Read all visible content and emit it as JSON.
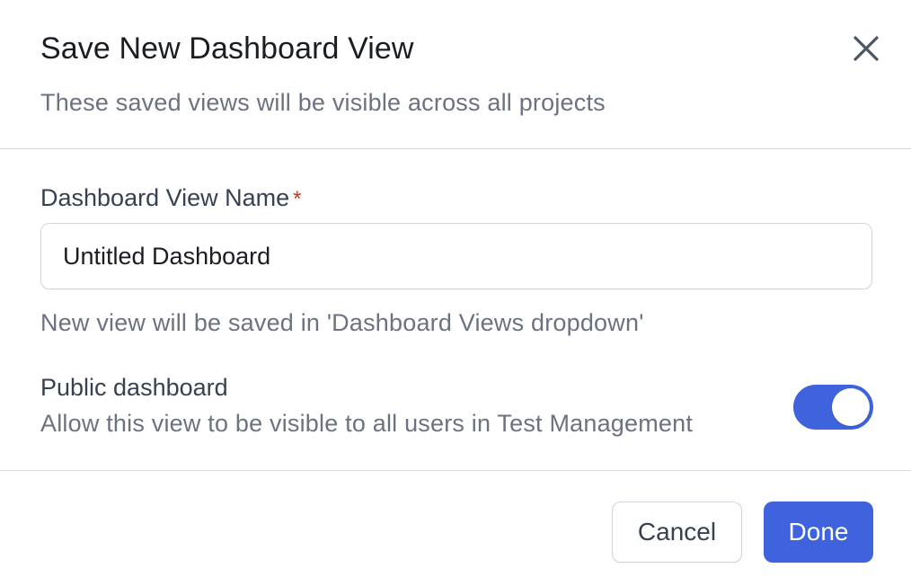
{
  "dialog": {
    "title": "Save New Dashboard View",
    "subtitle": "These saved views will be visible across all projects",
    "close_icon": "close-icon"
  },
  "name_field": {
    "label": "Dashboard View Name",
    "required_mark": "*",
    "value": "Untitled Dashboard",
    "helper": "New view will be saved in 'Dashboard Views dropdown'"
  },
  "public_toggle": {
    "title": "Public dashboard",
    "description": "Allow this view to be visible to all users in Test Management",
    "checked": true
  },
  "footer": {
    "cancel_label": "Cancel",
    "done_label": "Done"
  },
  "colors": {
    "accent": "#3e63dd",
    "required": "#c0392b",
    "muted_text": "#6b7280",
    "divider": "#d6d9de"
  }
}
